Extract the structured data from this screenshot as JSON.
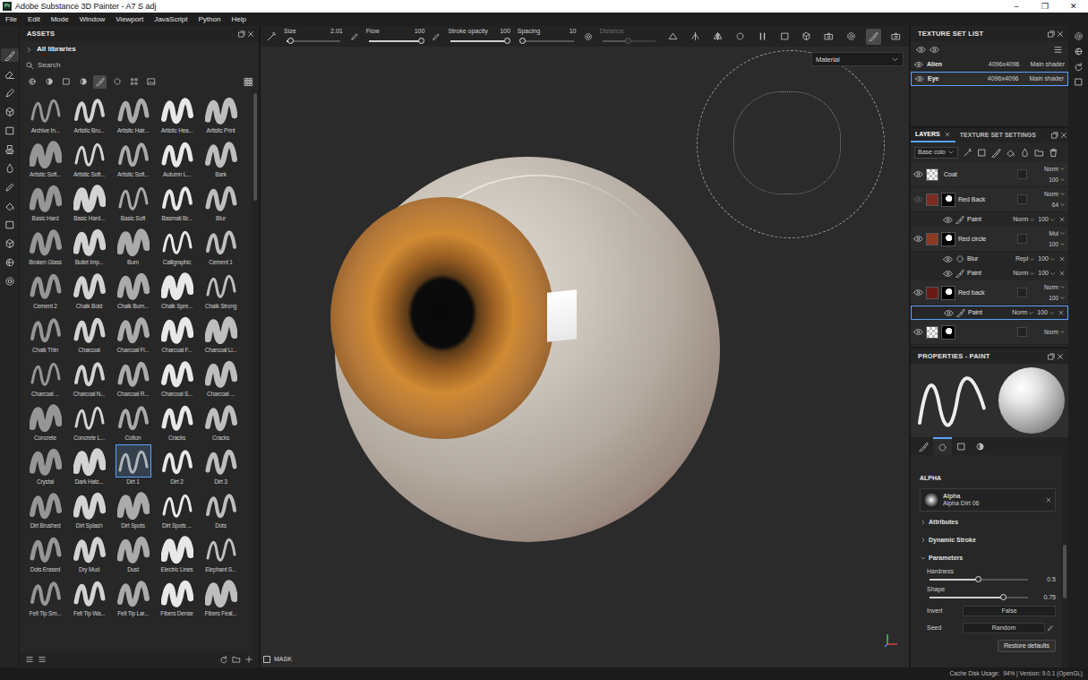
{
  "window": {
    "title": "Adobe Substance 3D Painter - A7 S adj",
    "logo": "Pt",
    "controls": [
      "–",
      "❐",
      "✕"
    ]
  },
  "menu": [
    "File",
    "Edit",
    "Mode",
    "Window",
    "Viewport",
    "JavaScript",
    "Python",
    "Help"
  ],
  "tools": [
    {
      "selected": true
    },
    {
      "selected": false
    },
    {
      "selected": false
    },
    {
      "selected": false
    },
    {
      "selected": false
    },
    {
      "selected": false
    },
    {
      "selected": false
    },
    {
      "selected": false
    },
    {
      "selected": false
    },
    {
      "selected": false
    },
    {
      "selected": false
    },
    {
      "selected": false
    },
    {
      "selected": false
    }
  ],
  "assets": {
    "title": "ASSETS",
    "library": "All libraries",
    "search": {
      "placeholder": "Search"
    },
    "filters": [
      {
        "selected": false
      },
      {
        "selected": false
      },
      {
        "selected": false
      },
      {
        "selected": false
      },
      {
        "selected": true
      },
      {
        "selected": false
      },
      {
        "selected": false
      },
      {
        "selected": false
      }
    ],
    "brushes": [
      {
        "label": "Archive In...",
        "selected": false
      },
      {
        "label": "Artistic Bru...",
        "selected": false
      },
      {
        "label": "Artistic Hair...",
        "selected": false
      },
      {
        "label": "Artistic Hea...",
        "selected": false
      },
      {
        "label": "Artistic Print",
        "selected": false
      },
      {
        "label": "Artistic Soft...",
        "selected": false
      },
      {
        "label": "Artistic Soft...",
        "selected": false
      },
      {
        "label": "Artistic Soft...",
        "selected": false
      },
      {
        "label": "Autumn L...",
        "selected": false
      },
      {
        "label": "Bark",
        "selected": false
      },
      {
        "label": "Basic Hard",
        "selected": false
      },
      {
        "label": "Basic Hard...",
        "selected": false
      },
      {
        "label": "Basic Soft",
        "selected": false
      },
      {
        "label": "Basmati Br...",
        "selected": false
      },
      {
        "label": "Blur",
        "selected": false
      },
      {
        "label": "Broken Glass",
        "selected": false
      },
      {
        "label": "Bullet Imp...",
        "selected": false
      },
      {
        "label": "Burn",
        "selected": false
      },
      {
        "label": "Calligraphic",
        "selected": false
      },
      {
        "label": "Cement 1",
        "selected": false
      },
      {
        "label": "Cement 2",
        "selected": false
      },
      {
        "label": "Chalk Bold",
        "selected": false
      },
      {
        "label": "Chalk Burn...",
        "selected": false
      },
      {
        "label": "Chalk Spre...",
        "selected": false
      },
      {
        "label": "Chalk Strong",
        "selected": false
      },
      {
        "label": "Chalk Thin",
        "selected": false
      },
      {
        "label": "Charcoal",
        "selected": false
      },
      {
        "label": "Charcoal Fi...",
        "selected": false
      },
      {
        "label": "Charcoal F...",
        "selected": false
      },
      {
        "label": "Charcoal Li...",
        "selected": false
      },
      {
        "label": "Charcoal ...",
        "selected": false
      },
      {
        "label": "Charcoal N...",
        "selected": false
      },
      {
        "label": "Charcoal R...",
        "selected": false
      },
      {
        "label": "Charcoal S...",
        "selected": false
      },
      {
        "label": "Charcoal ...",
        "selected": false
      },
      {
        "label": "Concrete",
        "selected": false
      },
      {
        "label": "Concrete L...",
        "selected": false
      },
      {
        "label": "Cotton",
        "selected": false
      },
      {
        "label": "Cracks",
        "selected": false
      },
      {
        "label": "Cracks",
        "selected": false
      },
      {
        "label": "Crystal",
        "selected": false
      },
      {
        "label": "Dark Hatc...",
        "selected": false
      },
      {
        "label": "Dirt 1",
        "selected": true
      },
      {
        "label": "Dirt 2",
        "selected": false
      },
      {
        "label": "Dirt 3",
        "selected": false
      },
      {
        "label": "Dirt Brushed",
        "selected": false
      },
      {
        "label": "Dirt Splash",
        "selected": false
      },
      {
        "label": "Dirt Spots",
        "selected": false
      },
      {
        "label": "Dirt Spots ...",
        "selected": false
      },
      {
        "label": "Dots",
        "selected": false
      },
      {
        "label": "Dots Erased",
        "selected": false
      },
      {
        "label": "Dry Mud",
        "selected": false
      },
      {
        "label": "Dust",
        "selected": false
      },
      {
        "label": "Electric Lines",
        "selected": false
      },
      {
        "label": "Elephant S...",
        "selected": false
      },
      {
        "label": "Felt Tip Sm...",
        "selected": false
      },
      {
        "label": "Felt Tip Wa...",
        "selected": false
      },
      {
        "label": "Felt Tip Lar...",
        "selected": false
      },
      {
        "label": "Fibers Dense",
        "selected": false
      },
      {
        "label": "Fibers Feat...",
        "selected": false
      }
    ]
  },
  "toolbar": {
    "sliders": [
      {
        "label": "Size",
        "value": "2.01",
        "level": 0.08,
        "disabled": false
      },
      {
        "label": "Flow",
        "value": "100",
        "level": 1,
        "disabled": false
      },
      {
        "label": "Stroke opacity",
        "value": "100",
        "level": 1,
        "disabled": false
      },
      {
        "label": "Spacing",
        "value": "10",
        "level": 0.05,
        "disabled": false
      },
      {
        "label": "Distance",
        "level": 0.5,
        "disabled": true
      }
    ],
    "toggles": [
      {
        "selected": false
      },
      {
        "selected": false
      },
      {
        "selected": false
      },
      {
        "selected": false
      },
      {
        "selected": false
      },
      {
        "selected": false
      },
      {
        "selected": false
      },
      {
        "selected": false
      },
      {
        "selected": false
      },
      {
        "selected": true
      },
      {
        "selected": false
      }
    ]
  },
  "viewport": {
    "material": "Material",
    "mask": {
      "label": "MASK",
      "checked": false
    }
  },
  "texture_sets": {
    "title": "TEXTURE SET LIST",
    "items": [
      {
        "name": "Alien",
        "size": "4096x4096",
        "shader": "Main shader",
        "selected": false
      },
      {
        "name": "Eye",
        "size": "4096x4096",
        "shader": "Main shader",
        "selected": true
      }
    ]
  },
  "layers": {
    "tabs": [
      {
        "label": "LAYERS",
        "selected": true
      },
      {
        "label": "TEXTURE SET SETTINGS",
        "selected": false
      }
    ],
    "channel": "Base colo",
    "rows": [
      {
        "kind": "layer",
        "name": "Coat",
        "blend": "Norm",
        "opacity": "100",
        "visible": true,
        "has_mask": false
      },
      {
        "kind": "layer",
        "name": "Red Back",
        "blend": "Norm",
        "opacity": "64",
        "visible": false,
        "has_mask": true,
        "color": "#7a2c24"
      },
      {
        "kind": "effect",
        "name": "Paint",
        "blend": "Norm",
        "opacity": "100",
        "visible": true,
        "selected": false
      },
      {
        "kind": "layer",
        "name": "Red circle",
        "blend": "Mul",
        "opacity": "100",
        "visible": true,
        "has_mask": true,
        "color": "#8c3a22"
      },
      {
        "kind": "effect",
        "name": "Blur",
        "blend": "Repl",
        "opacity": "100",
        "visible": true,
        "selected": false
      },
      {
        "kind": "effect",
        "name": "Paint",
        "blend": "Norm",
        "opacity": "100",
        "visible": true,
        "selected": false
      },
      {
        "kind": "layer",
        "name": "Red back",
        "blend": "Norm",
        "opacity": "100",
        "visible": true,
        "has_mask": true,
        "color": "#6a1a16"
      },
      {
        "kind": "effect",
        "name": "Paint",
        "blend": "Norm",
        "opacity": "100",
        "visible": true,
        "selected": true
      },
      {
        "kind": "layer",
        "blend": "Norm",
        "visible": true,
        "has_mask": true
      }
    ]
  },
  "properties": {
    "title": "PROPERTIES - PAINT",
    "tabs": [
      {
        "selected": false
      },
      {
        "selected": true
      },
      {
        "selected": false
      },
      {
        "selected": false
      }
    ],
    "section": "ALPHA",
    "alpha": {
      "label": "Alpha",
      "name": "Alpha Dirt 06"
    },
    "groups": [
      {
        "label": "Attributes",
        "expanded": false
      },
      {
        "label": "Dynamic Stroke",
        "expanded": false
      },
      {
        "label": "Parameters",
        "expanded": true
      }
    ],
    "params": [
      {
        "kind": "slider",
        "label": "Hardness",
        "value": "0.5",
        "level": 0.5
      },
      {
        "kind": "slider",
        "label": "Shape",
        "value": "0.75",
        "level": 0.75
      },
      {
        "kind": "field",
        "label": "Invert",
        "value": "False"
      },
      {
        "kind": "field",
        "label": "Seed",
        "value": "Random"
      }
    ],
    "button": "Restore defaults"
  },
  "status_bar": {
    "label": "Cache Disk Usage:",
    "text": "94% | Version: 9.0.1 (OpenGL)"
  }
}
